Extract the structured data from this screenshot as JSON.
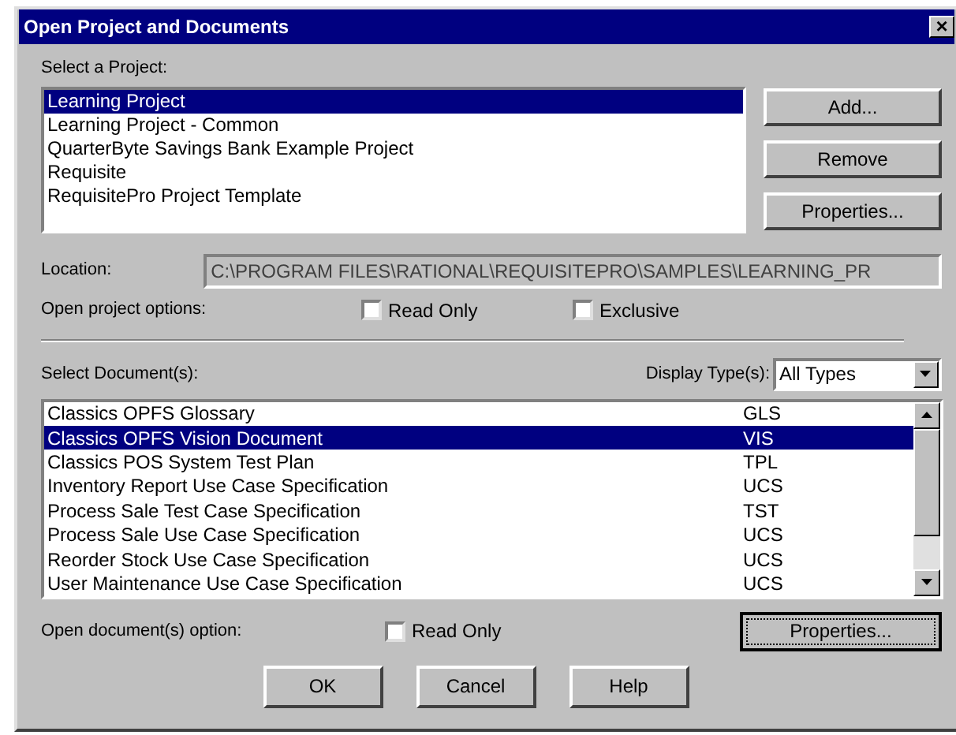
{
  "window": {
    "title": "Open Project and Documents",
    "close": "×"
  },
  "project_list": {
    "label": "Select a Project:",
    "items": [
      {
        "text": "Learning Project",
        "selected": true
      },
      {
        "text": "Learning Project - Common",
        "selected": false
      },
      {
        "text": "QuarterByte Savings Bank Example Project",
        "selected": false
      },
      {
        "text": "Requisite",
        "selected": false
      },
      {
        "text": "RequisitePro Project Template",
        "selected": false
      }
    ]
  },
  "project_buttons": [
    {
      "label": "Add..."
    },
    {
      "label": "Remove"
    },
    {
      "label": "Properties..."
    }
  ],
  "location": {
    "label": "Location:",
    "value": "C:\\PROGRAM FILES\\RATIONAL\\REQUISITEPRO\\SAMPLES\\LEARNING_PR"
  },
  "project_options": {
    "label": "Open project options:",
    "checkboxes": [
      {
        "label": "Read Only",
        "checked": false
      },
      {
        "label": "Exclusive",
        "checked": false
      }
    ]
  },
  "document_list": {
    "label": "Select Document(s):",
    "display_type": {
      "label": "Display Type(s):",
      "value": "All Types"
    },
    "rows": [
      {
        "name": "Classics OPFS Glossary",
        "type": "GLS",
        "selected": false
      },
      {
        "name": "Classics OPFS Vision Document",
        "type": "VIS",
        "selected": true
      },
      {
        "name": "Classics POS System Test Plan",
        "type": "TPL",
        "selected": false
      },
      {
        "name": "Inventory Report Use Case Specification",
        "type": "UCS",
        "selected": false
      },
      {
        "name": "Process Sale Test Case Specification",
        "type": "TST",
        "selected": false
      },
      {
        "name": "Process Sale Use Case Specification",
        "type": "UCS",
        "selected": false
      },
      {
        "name": "Reorder Stock Use Case Specification",
        "type": "UCS",
        "selected": false
      },
      {
        "name": "User Maintenance Use Case Specification",
        "type": "UCS",
        "selected": false
      }
    ]
  },
  "document_options": {
    "label": "Open document(s) option:",
    "checkboxes": [
      {
        "label": "Read Only",
        "checked": false
      }
    ],
    "properties_button": {
      "label": "Properties...",
      "default": true
    }
  },
  "buttons": [
    {
      "label": "OK"
    },
    {
      "label": "Cancel"
    },
    {
      "label": "Help"
    }
  ]
}
